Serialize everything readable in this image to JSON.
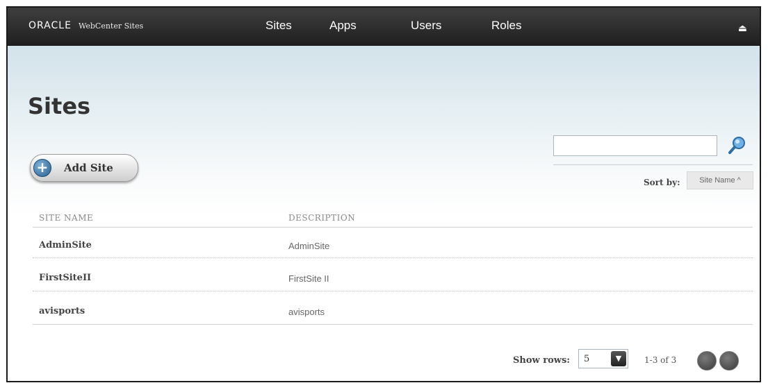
{
  "header": {
    "brand": "ORACLE",
    "product": "WebCenter Sites",
    "nav": [
      {
        "label": "Sites"
      },
      {
        "label": "Apps"
      },
      {
        "label": "Users"
      },
      {
        "label": "Roles"
      }
    ],
    "eject_icon": "eject-icon"
  },
  "page": {
    "title": "Sites",
    "add_button_label": "Add Site"
  },
  "search": {
    "value": "",
    "placeholder": "",
    "icon": "search-icon"
  },
  "sort": {
    "label": "Sort by:",
    "selected": "Site Name ^"
  },
  "table": {
    "columns": [
      "SITE NAME",
      "DESCRIPTION"
    ],
    "rows": [
      {
        "name": "AdminSite",
        "description": "AdminSite"
      },
      {
        "name": "FirstSiteII",
        "description": "FirstSite II"
      },
      {
        "name": "avisports",
        "description": "avisports"
      }
    ]
  },
  "pagination": {
    "rows_label": "Show rows:",
    "rows_value": "5",
    "range": "1-3 of 3"
  }
}
